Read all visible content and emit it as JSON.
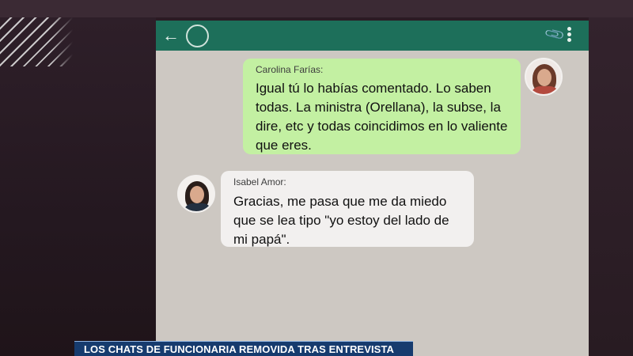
{
  "chat": {
    "messages": [
      {
        "sender": "Carolina Farías:",
        "text": "Igual tú lo habías comentado. Lo saben todas. La ministra (Orellana), la subse, la dire, etc y todas coincidimos en lo valiente que eres.",
        "direction": "outgoing",
        "bubble_color": "#c3f0a2"
      },
      {
        "sender": "Isabel Amor:",
        "text": "Gracias, me pasa que me da miedo que se lea tipo \"yo estoy del lado de mi papá\".",
        "direction": "incoming",
        "bubble_color": "#f2f0ef"
      }
    ],
    "header_color": "#1d6f5a",
    "icons": {
      "back": "back-arrow-icon",
      "attach": "paperclip-icon",
      "menu": "more-vertical-icon"
    }
  },
  "banner": {
    "text": "LOS CHATS DE FUNCIONARIA REMOVIDA TRAS ENTREVISTA",
    "color": "#163b6e"
  }
}
